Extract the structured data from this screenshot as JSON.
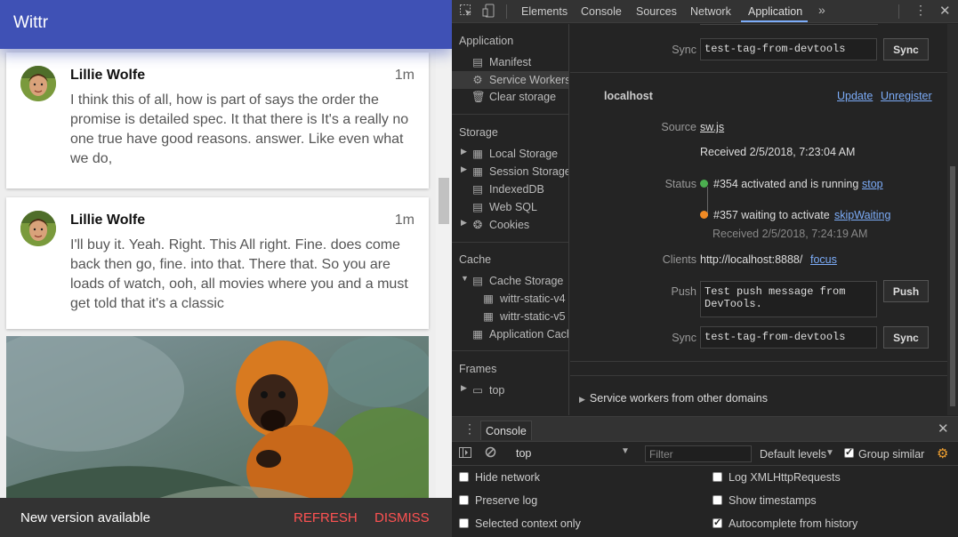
{
  "app": {
    "title": "Wittr",
    "posts": [
      {
        "author": "Lillie Wolfe",
        "time": "1m",
        "body": "I think this of all, how is part of says the order the promise is detailed spec. It that there is It's a really no one true have good reasons. answer. Like even what we do,"
      },
      {
        "author": "Lillie Wolfe",
        "time": "1m",
        "body": "I'll buy it. Yeah. Right. This All right. Fine. does come back then go, fine. into that. There that. So you are loads of watch, ooh, all movies where you and a must get told that it's a classic"
      }
    ],
    "toast": {
      "message": "New version available",
      "refresh": "REFRESH",
      "dismiss": "DISMISS"
    },
    "colors": {
      "header": "#3f51b5",
      "toast_action": "#ff5252"
    }
  },
  "devtools": {
    "tabs": [
      "Elements",
      "Console",
      "Sources",
      "Network",
      "Application"
    ],
    "active_tab": "Application",
    "more_tabs": "»",
    "sidebar": {
      "application": {
        "title": "Application",
        "items": [
          "Manifest",
          "Service Workers",
          "Clear storage"
        ]
      },
      "storage": {
        "title": "Storage",
        "items": [
          "Local Storage",
          "Session Storage",
          "IndexedDB",
          "Web SQL",
          "Cookies"
        ]
      },
      "cache": {
        "title": "Cache",
        "items": [
          "Cache Storage",
          "wittr-static-v4",
          "wittr-static-v5",
          "Application Cache"
        ]
      },
      "frames": {
        "title": "Frames",
        "items": [
          "top"
        ]
      }
    },
    "service_worker": {
      "top_sync": {
        "label": "Sync",
        "value": "test-tag-from-devtools",
        "button": "Sync"
      },
      "origin": "localhost",
      "update": "Update",
      "unregister": "Unregister",
      "source_label": "Source",
      "source_file": "sw.js",
      "received": "Received 2/5/2018, 7:23:04 AM",
      "status_label": "Status",
      "active_status": "#354 activated and is running",
      "stop": "stop",
      "waiting_status": "#357 waiting to activate",
      "skip_waiting": "skipWaiting",
      "waiting_received": "Received 2/5/2018, 7:24:19 AM",
      "clients_label": "Clients",
      "client_url": "http://localhost:8888/",
      "focus": "focus",
      "push_label": "Push",
      "push_value": "Test push message from DevTools.",
      "push_button": "Push",
      "sync_label": "Sync",
      "sync_value": "test-tag-from-devtools",
      "sync_button": "Sync",
      "other_domains": "Service workers from other domains",
      "colors": {
        "active": "#4caf50",
        "waiting": "#f08a24"
      }
    },
    "drawer": {
      "tab": "Console",
      "context": "top",
      "filter_placeholder": "Filter",
      "levels": "Default levels",
      "group_similar": "Group similar",
      "settings": [
        {
          "label": "Hide network",
          "checked": false
        },
        {
          "label": "Log XMLHttpRequests",
          "checked": false
        },
        {
          "label": "Preserve log",
          "checked": false
        },
        {
          "label": "Show timestamps",
          "checked": false
        },
        {
          "label": "Selected context only",
          "checked": false
        },
        {
          "label": "Autocomplete from history",
          "checked": true
        }
      ]
    }
  }
}
